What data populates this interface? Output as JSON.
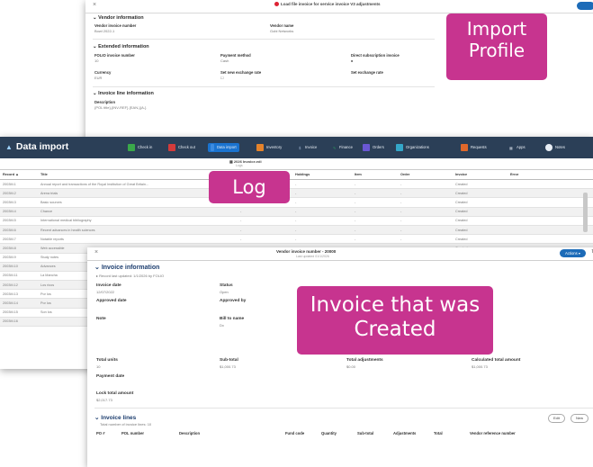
{
  "profile": {
    "close_icon": "×",
    "title": "Load file invoice for service invoice V3 adjustments",
    "subtitle": "Last updated 01/1/2026",
    "section1_title": "Vendor information",
    "vendor_invoice_number_label": "Vendor invoice number",
    "vendor_invoice_number_value": "Bowl 2022-1",
    "vendor_name_label": "Vendor name",
    "vendor_name_value": "Gobi Networks",
    "section2_title": "Extended information",
    "folio_label": "FOLIO invoice number",
    "folio_value": "10",
    "payment_method_label": "Payment method",
    "payment_method_value": "Cash",
    "direct_subscription_label": "Direct subscription invoice",
    "direct_subscription_value": "■",
    "currency_label": "Currency",
    "currency_value": "EUR",
    "set_exchange_label": "Set new exchange rate",
    "set_exchange_value": "☐",
    "exchange_rate_label": "Set exchange rate",
    "exchange_rate_value": "",
    "section3_title": "Invoice line information",
    "description_label": "Description",
    "description_value": "{POL title},{INV-REF} {EAN-}{A-}"
  },
  "log": {
    "app_title": "Data import",
    "nav": [
      {
        "label": "Check in",
        "color": "#3aa84a"
      },
      {
        "label": "Check out",
        "color": "#d33b3b"
      },
      {
        "label": "Data import",
        "color": "#3c8be0"
      },
      {
        "label": "Inventory",
        "color": "#e5832b"
      },
      {
        "label": "Invoice",
        "color": "#8ea6c2"
      },
      {
        "label": "Finance",
        "color": "#2b9a5d"
      },
      {
        "label": "Orders",
        "color": "#6a57d4"
      },
      {
        "label": "Organizations",
        "color": "#34a7c9"
      },
      {
        "label": "Requests",
        "color": "#e0682b"
      },
      {
        "label": "Apps",
        "color": "#8ea6c2"
      },
      {
        "label": "Notes",
        "color": "#8ea6c2"
      }
    ],
    "sub_title": "2026 Invoice.edi",
    "sub_subtitle": "Logs",
    "headers": [
      "Record ▲",
      "Title",
      "",
      "Instance",
      "Holdings",
      "Item",
      "Order",
      "Invoice",
      "Error"
    ],
    "rows": [
      [
        "2003M.1",
        "Annual report and transactions of the Royal Institution of Great Britain...",
        "",
        "-",
        "-",
        "-",
        "-",
        "Created",
        ""
      ],
      [
        "2003M.2",
        "Arena trials",
        "",
        "-",
        "-",
        "-",
        "-",
        "Created",
        ""
      ],
      [
        "2003M.3",
        "Basic sources",
        "",
        "-",
        "-",
        "-",
        "-",
        "Created",
        ""
      ],
      [
        "2003M.4",
        "Chance",
        "",
        "-",
        "-",
        "-",
        "-",
        "Created",
        ""
      ],
      [
        "2003M.5",
        "International medical bibliography",
        "",
        "-",
        "-",
        "-",
        "-",
        "Created",
        ""
      ],
      [
        "2003M.6",
        "Recent advances in health sciences",
        "",
        "-",
        "-",
        "-",
        "-",
        "Created",
        ""
      ],
      [
        "2003M.7",
        "Notable reports",
        "",
        "-",
        "-",
        "-",
        "-",
        "Created",
        ""
      ],
      [
        "2003M.8",
        "Web accessible",
        "",
        "-",
        "-",
        "-",
        "-",
        "Created",
        ""
      ],
      [
        "2003M.9",
        "Study notes",
        "",
        "-",
        "-",
        "-",
        "-",
        "Created",
        ""
      ],
      [
        "2003M.10",
        "Advances",
        "",
        "-",
        "-",
        "-",
        "-",
        "Created",
        ""
      ],
      [
        "2003M.11",
        "La Mancha",
        "",
        "-",
        "-",
        "-",
        "-",
        "Created",
        ""
      ],
      [
        "2003M.12",
        "Los ricos",
        "",
        "-",
        "-",
        "-",
        "-",
        "Created",
        ""
      ],
      [
        "2003M.13",
        "Por los",
        "",
        "-",
        "-",
        "-",
        "-",
        "Created",
        ""
      ],
      [
        "2003M.14",
        "Por los",
        "",
        "-",
        "-",
        "-",
        "-",
        "Created",
        ""
      ],
      [
        "2003M.15",
        "Son los",
        "",
        "-",
        "-",
        "-",
        "-",
        "Created",
        ""
      ],
      [
        "2003M.16",
        "",
        "",
        "-",
        "-",
        "-",
        "-",
        "Created",
        ""
      ]
    ]
  },
  "invoice": {
    "close_icon": "×",
    "title": "Vendor invoice number - 20000",
    "subtitle": "Last updated 01/1/2026",
    "actions_label": "Actions ▾",
    "refresh_icon": "↻",
    "section_title": "Invoice information",
    "sub_note": "▸ Record last updated: 1/1/2026 by FOLIO",
    "invoice_date_label": "Invoice date",
    "invoice_date_value": "12/07/2022",
    "status_label": "Status",
    "status_value": "Open",
    "approved_date_label": "Approved date",
    "approved_date_value": "",
    "approved_by_label": "Approved by",
    "approved_by_value": "",
    "note_label": "Note",
    "bill_to_label": "Bill to name",
    "bill_to_value": "Dx",
    "address_line": "Address",
    "address_value": "550 Main Street, St. Frame Nobe",
    "total_units_label": "Total units",
    "total_units_value": "10",
    "sub_total_label": "Sub-total",
    "sub_total_value": "$1,000.73",
    "total_adj_label": "Total adjustments",
    "total_adj_value": "$0.00",
    "calc_total_label": "Calculated total amount",
    "calc_total_value": "$1,000.73",
    "payment_date_label": "Payment date",
    "lock_total_label": "Lock total amount",
    "lock_total_value": "$2,017.73",
    "lines_title": "Invoice lines",
    "lines_count": "Total number of invoice lines: 10",
    "edit_label": "Edit",
    "new_label": "New",
    "line_headers": [
      "PO #",
      "POL number",
      "Description",
      "",
      "Fund code",
      "Quantity",
      "Sub-total",
      "Adjustments",
      "Total",
      "Vendor reference number"
    ]
  },
  "callouts": {
    "import_profile": "Import Profile",
    "log": "Log",
    "invoice": "Invoice that was Created"
  }
}
